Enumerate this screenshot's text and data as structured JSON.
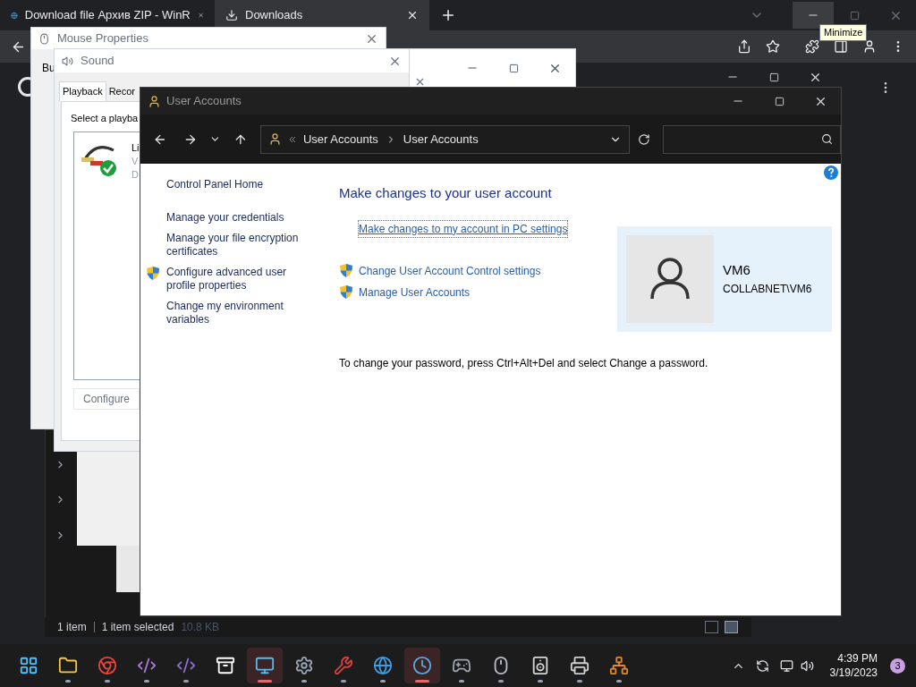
{
  "browser": {
    "tabs": [
      {
        "title": "Download file Архив ZIP - WinR",
        "selected": false
      },
      {
        "title": "Downloads",
        "selected": true
      }
    ],
    "tooltip": "Minimize"
  },
  "explorer": {
    "status": [
      "1 item",
      "1 item selected",
      "10.8 KB"
    ]
  },
  "mouse_window": {
    "title": "Mouse Properties",
    "tab": "Bu"
  },
  "sound_window": {
    "title": "Sound",
    "tabs": [
      {
        "label": "Playback",
        "selected": true
      },
      {
        "label": "Recor",
        "selected": false
      }
    ],
    "instruction": "Select a playba",
    "device_lines": [
      "Li",
      "V",
      "D"
    ],
    "button": "Configure"
  },
  "user_accounts": {
    "title": "User Accounts",
    "breadcrumb": [
      "User Accounts",
      "User Accounts"
    ],
    "sidebar": [
      {
        "label": "Control Panel Home",
        "shield": false
      },
      {
        "label": "Manage your credentials",
        "shield": false
      },
      {
        "label": "Manage your file encryption certificates",
        "shield": false
      },
      {
        "label": "Configure advanced user profile properties",
        "shield": true
      },
      {
        "label": "Change my environment variables",
        "shield": false
      }
    ],
    "heading": "Make changes to your user account",
    "pc_settings_link": "Make changes to my account in PC settings",
    "tasks": [
      {
        "label": "Change User Account Control settings",
        "shield": true
      },
      {
        "label": "Manage User Accounts",
        "shield": true
      }
    ],
    "user": {
      "name": "VM6",
      "account": "COLLABNET\\VM6"
    },
    "note": "To change your password, press Ctrl+Alt+Del and select Change a password."
  },
  "taskbar": {
    "apps": [
      {
        "kind": "start",
        "running": false,
        "active": false
      },
      {
        "kind": "folder",
        "running": true,
        "active": false
      },
      {
        "kind": "chrome",
        "running": true,
        "active": false
      },
      {
        "kind": "studio",
        "running": true,
        "active": false
      },
      {
        "kind": "installer",
        "running": true,
        "active": false
      },
      {
        "kind": "archiver",
        "running": false,
        "active": false
      },
      {
        "kind": "control",
        "running": true,
        "active": true
      },
      {
        "kind": "gear",
        "running": true,
        "active": false
      },
      {
        "kind": "toolbox",
        "running": true,
        "active": false
      },
      {
        "kind": "globe",
        "running": true,
        "active": false
      },
      {
        "kind": "clock",
        "running": true,
        "active": true
      },
      {
        "kind": "gamepad",
        "running": true,
        "active": false
      },
      {
        "kind": "mouse",
        "running": true,
        "active": false
      },
      {
        "kind": "speaker",
        "running": true,
        "active": false
      },
      {
        "kind": "printer",
        "running": true,
        "active": false
      },
      {
        "kind": "network",
        "running": true,
        "active": false
      }
    ],
    "time": "4:39 PM",
    "date": "3/19/2023",
    "notifications": "3"
  }
}
